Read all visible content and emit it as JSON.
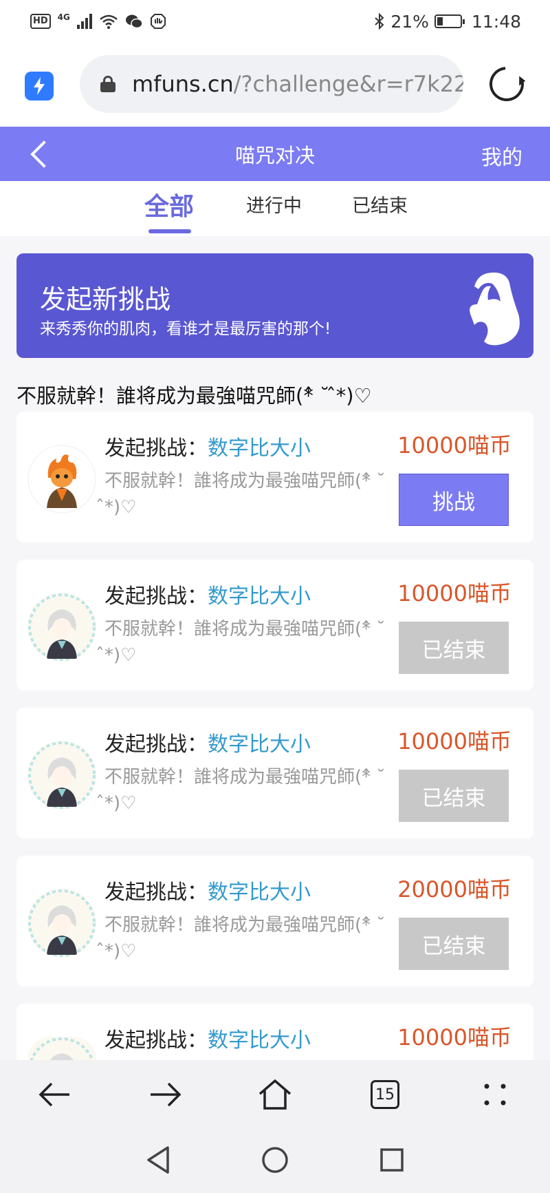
{
  "status_bar": {
    "hd": "HD",
    "network": "4G",
    "battery": "21%",
    "time": "11:48"
  },
  "browser": {
    "url_host": "mfuns.cn",
    "url_path": "/?challenge&r=r7k22",
    "tab_count": "15"
  },
  "header": {
    "title": "喵咒对决",
    "mine_label": "我的"
  },
  "tabs": [
    {
      "label": "全部",
      "active": true
    },
    {
      "label": "进行中",
      "active": false
    },
    {
      "label": "已结束",
      "active": false
    }
  ],
  "banner": {
    "title": "发起新挑战",
    "subtitle": "来秀秀你的肌肉，看谁才是最厉害的那个!"
  },
  "slogan": "不服就幹！誰将成为最強喵咒師(*̂ ˘ ̂*)♡",
  "challenges": [
    {
      "prefix": "发起挑战：",
      "game": "数字比大小",
      "desc": "不服就幹！誰将成为最強喵咒師(*̂ ˘ ̂*)♡",
      "coins": "10000喵币",
      "button": "挑战",
      "status": "active"
    },
    {
      "prefix": "发起挑战：",
      "game": "数字比大小",
      "desc": "不服就幹！誰将成为最強喵咒師(*̂ ˘ ̂*)♡",
      "coins": "10000喵币",
      "button": "已结束",
      "status": "ended"
    },
    {
      "prefix": "发起挑战：",
      "game": "数字比大小",
      "desc": "不服就幹！誰将成为最強喵咒師(*̂ ˘ ̂*)♡",
      "coins": "10000喵币",
      "button": "已结束",
      "status": "ended"
    },
    {
      "prefix": "发起挑战：",
      "game": "数字比大小",
      "desc": "不服就幹！誰将成为最強喵咒師(*̂ ˘ ̂*)♡",
      "coins": "20000喵币",
      "button": "已结束",
      "status": "ended"
    },
    {
      "prefix": "发起挑战：",
      "game": "数字比大小",
      "coins": "10000喵币"
    }
  ],
  "colors": {
    "accent": "#7b7bf3",
    "banner": "#5a57d2",
    "coin": "#d9562a",
    "game_link": "#3399cc",
    "ended_button": "#c8c8c8"
  },
  "icons": {
    "back": "chevron-left-icon",
    "banner": "muscle-arm-icon",
    "lock": "lock-icon",
    "reload": "reload-icon",
    "browser_logo": "lightning-icon"
  }
}
